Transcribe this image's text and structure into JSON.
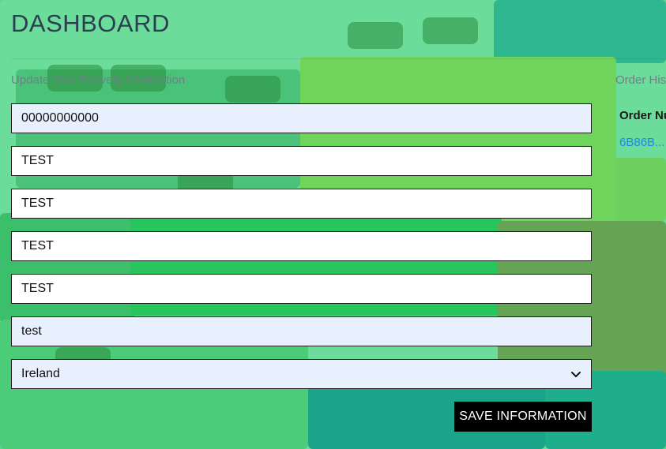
{
  "page": {
    "title": "DASHBOARD"
  },
  "delivery": {
    "heading": "Update Your Delivery Information",
    "fields": [
      {
        "value": "00000000000"
      },
      {
        "value": "TEST"
      },
      {
        "value": "TEST"
      },
      {
        "value": "TEST"
      },
      {
        "value": "TEST"
      },
      {
        "value": "test"
      }
    ],
    "country": {
      "selected": "Ireland"
    },
    "save_label": "SAVE INFORMATION"
  },
  "orders": {
    "heading": "Order His",
    "column_header": "Order Nu",
    "rows": [
      {
        "order_number": "6B86B..."
      }
    ]
  },
  "colors": {
    "autofill_background": "#e8f0fe",
    "button_background": "#000000",
    "link": "#1e88e5",
    "title": "#2c3e50"
  }
}
